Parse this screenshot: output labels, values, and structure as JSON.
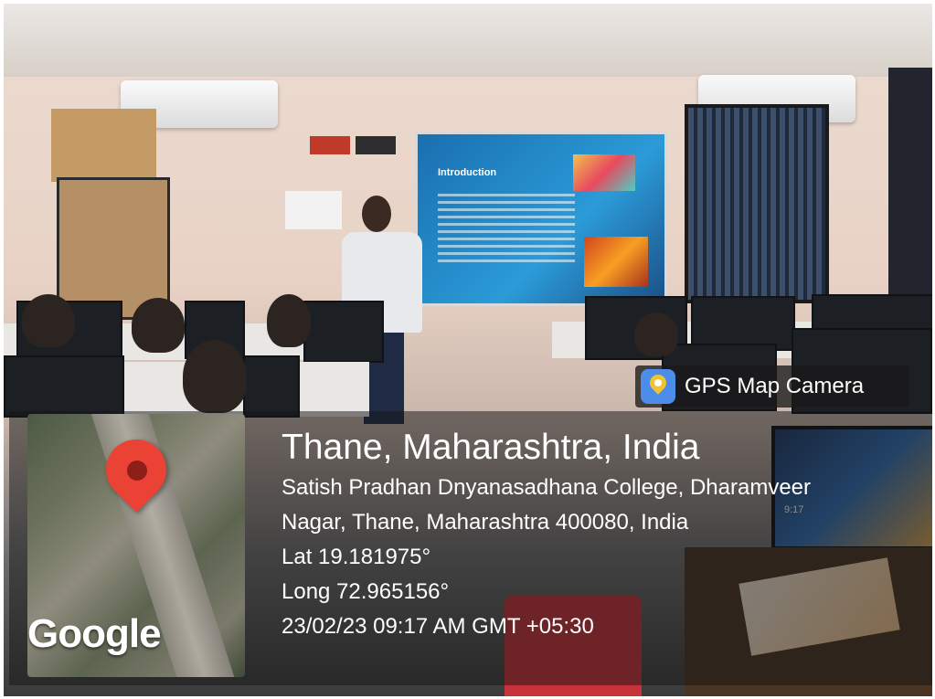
{
  "watermark_app": {
    "name": "GPS Map Camera",
    "icon": "map-pin-app-icon"
  },
  "location": {
    "city_line": "Thane, Maharashtra, India",
    "address_line1": "Satish Pradhan Dnyanasadhana College, Dharamveer",
    "address_line2": "Nagar, Thane, Maharashtra 400080, India",
    "latitude": "Lat 19.181975°",
    "longitude": "Long 72.965156°",
    "datetime": "23/02/23 09:17 AM GMT +05:30"
  },
  "map_thumbnail": {
    "logo_text": "Google",
    "pin_color": "#ea4335"
  },
  "projector_slide": {
    "title": "Introduction"
  },
  "desktop_clock": {
    "time": "9:17"
  }
}
